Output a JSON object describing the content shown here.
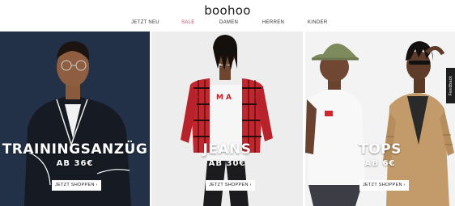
{
  "header": {
    "logo": "boohoo",
    "nav": [
      {
        "label": "JETZT NEU"
      },
      {
        "label": "SALE"
      },
      {
        "label": "DAMEN"
      },
      {
        "label": "HERREN"
      },
      {
        "label": "KINDER"
      }
    ]
  },
  "panels": [
    {
      "title": "TRAININGSANZÜG",
      "subtitle": "AB 36€",
      "button": "JETZT SHOPPEN ›"
    },
    {
      "title": "JEANS",
      "subtitle": "AB 30€",
      "button": "JETZT SHOPPEN ›"
    },
    {
      "title": "TOPS",
      "subtitle": "AB 6€",
      "button": "JETZT SHOPPEN ›"
    }
  ],
  "feedback": {
    "label": "Feedback"
  },
  "colors": {
    "sale": "#e5395a",
    "background": "#ffffff"
  }
}
